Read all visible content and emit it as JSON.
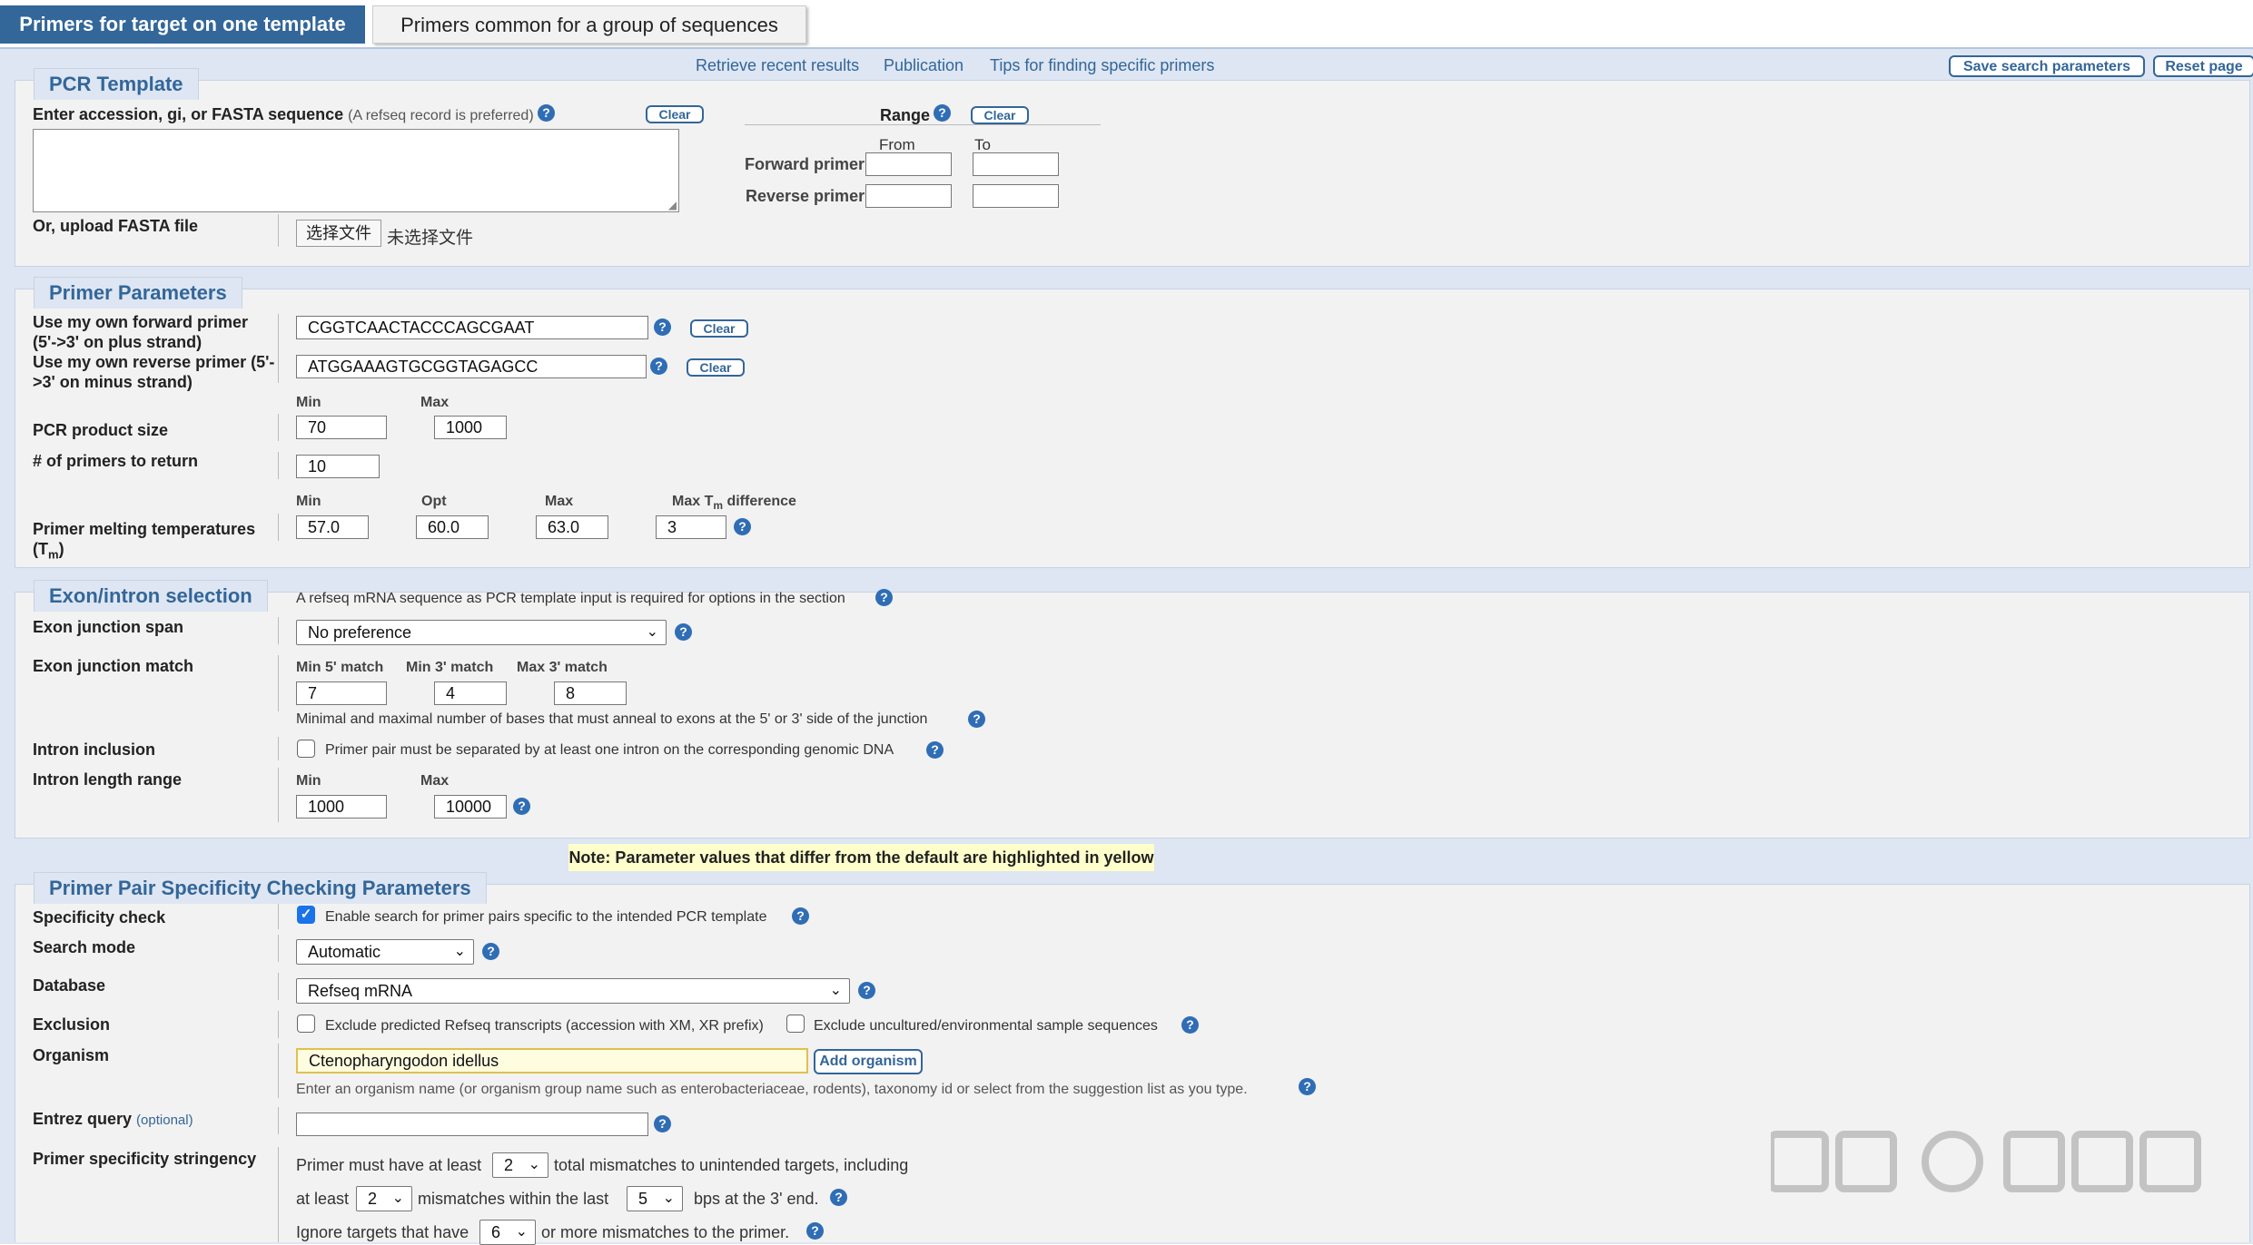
{
  "tabs": {
    "active": "Primers for target on one template",
    "inactive": "Primers common for a group of sequences"
  },
  "top_links": {
    "recent": "Retrieve recent results",
    "publication": "Publication",
    "tips": "Tips for finding specific primers"
  },
  "top_buttons": {
    "save": "Save search parameters",
    "reset": "Reset page"
  },
  "pcr_template": {
    "legend": "PCR Template",
    "enter_label": "Enter accession, gi, or FASTA sequence",
    "enter_hint": "(A refseq record is preferred)",
    "clear": "Clear",
    "range_label": "Range",
    "range_clear": "Clear",
    "from": "From",
    "to": "To",
    "forward_primer": "Forward primer",
    "reverse_primer": "Reverse primer",
    "upload_label": "Or, upload FASTA file",
    "choose_file": "选择文件",
    "no_file": "未选择文件",
    "sequence_value": ""
  },
  "primer_params": {
    "legend": "Primer Parameters",
    "own_forward_label_1": "Use my own forward primer",
    "own_forward_label_2": "(5'->3' on plus strand)",
    "own_forward_value": "CGGTCAACTACCCAGCGAAT",
    "own_reverse_label_1": "Use my own reverse primer (5'-",
    "own_reverse_label_2": ">3' on minus strand)",
    "own_reverse_value": "ATGGAAAGTGCGGTAGAGCC",
    "clear": "Clear",
    "min": "Min",
    "max": "Max",
    "opt": "Opt",
    "product_size_label": "PCR product size",
    "product_min": "70",
    "product_max": "1000",
    "num_return_label": "# of primers to return",
    "num_return": "10",
    "tm_label_1": "Primer melting temperatures",
    "tm_label_2": "(T",
    "tm_label_sub": "m",
    "tm_label_3": ")",
    "tm_diff_label_a": "Max T",
    "tm_diff_label_sub": "m",
    "tm_diff_label_b": " difference",
    "tm_min": "57.0",
    "tm_opt": "60.0",
    "tm_max": "63.0",
    "tm_diff": "3"
  },
  "exon": {
    "legend": "Exon/intron selection",
    "note": "A refseq mRNA sequence as PCR template input is required for options in the section",
    "span_label": "Exon junction span",
    "span_value": "No preference",
    "match_label": "Exon junction match",
    "min5": "Min 5' match",
    "min3": "Min 3' match",
    "max3": "Max 3' match",
    "min5_val": "7",
    "min3_val": "4",
    "max3_val": "8",
    "match_hint": "Minimal and maximal number of bases that must anneal to exons at the 5' or 3' side of the junction",
    "intron_incl_label": "Intron inclusion",
    "intron_incl_text": "Primer pair must be separated by at least one intron on the corresponding genomic DNA",
    "intron_len_label": "Intron length range",
    "min": "Min",
    "max": "Max",
    "intron_min": "1000",
    "intron_max": "10000"
  },
  "note_banner": "Note: Parameter values that differ from the default are highlighted in yellow",
  "specificity": {
    "legend": "Primer Pair Specificity Checking Parameters",
    "check_label": "Specificity check",
    "check_text": "Enable search for primer pairs specific to the intended PCR template",
    "mode_label": "Search mode",
    "mode_value": "Automatic",
    "db_label": "Database",
    "db_value": "Refseq mRNA",
    "excl_label": "Exclusion",
    "excl_pred": "Exclude predicted Refseq transcripts (accession with XM, XR prefix)",
    "excl_unc": "Exclude uncultured/environmental sample sequences",
    "org_label": "Organism",
    "org_value": "Ctenopharyngodon idellus",
    "add_org": "Add organism",
    "org_hint": "Enter an organism name (or organism group name such as enterobacteriaceae, rodents), taxonomy id or select from the suggestion list as you type.",
    "entrez_label": "Entrez query",
    "entrez_opt": "(optional)",
    "entrez_value": "",
    "stringency_label": "Primer specificity stringency",
    "s1a": "Primer must have at least",
    "s1_val": "2",
    "s1b": "total mismatches to unintended targets, including",
    "s2a": "at least",
    "s2_val": "2",
    "s2b": "mismatches within the last",
    "s2_val2": "5",
    "s2c": "bps at the 3' end.",
    "s3a": "Ignore targets that have",
    "s3_val": "6",
    "s3b": "or more mismatches to the primer."
  },
  "watermark": "知乎 @杨小清",
  "colors": {
    "brand_blue": "#336699",
    "help_blue": "#2f6db5",
    "band": "#dde6f2",
    "panel": "#f2f2f2",
    "highlight_yellow": "#ffffcc"
  },
  "icons": {
    "help": "question-circle-icon",
    "dropdown": "chevron-down-icon",
    "checkbox": "checkbox-icon",
    "resize": "resize-grip-icon"
  }
}
